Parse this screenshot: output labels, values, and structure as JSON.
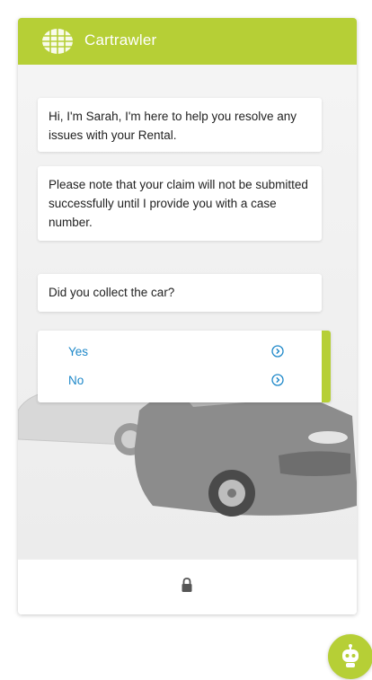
{
  "header": {
    "brand": "Cartrawler",
    "logo_icon": "cartrawler-globe-logo"
  },
  "messages": [
    {
      "text": "Hi, I'm Sarah, I'm here to help you resolve any issues with your Rental."
    },
    {
      "text": "Please note that your claim will not be submitted successfully until I provide you with a case number."
    },
    {
      "text": "Did you collect the car?"
    }
  ],
  "choices": [
    {
      "label": "Yes",
      "icon": "chevron-right-circle-icon"
    },
    {
      "label": "No",
      "icon": "chevron-right-circle-icon"
    }
  ],
  "footer": {
    "icon": "lock-icon"
  },
  "launcher": {
    "icon": "robot-icon"
  },
  "colors": {
    "accent": "#b6cf36",
    "link": "#1e88c9",
    "text": "#222222"
  }
}
